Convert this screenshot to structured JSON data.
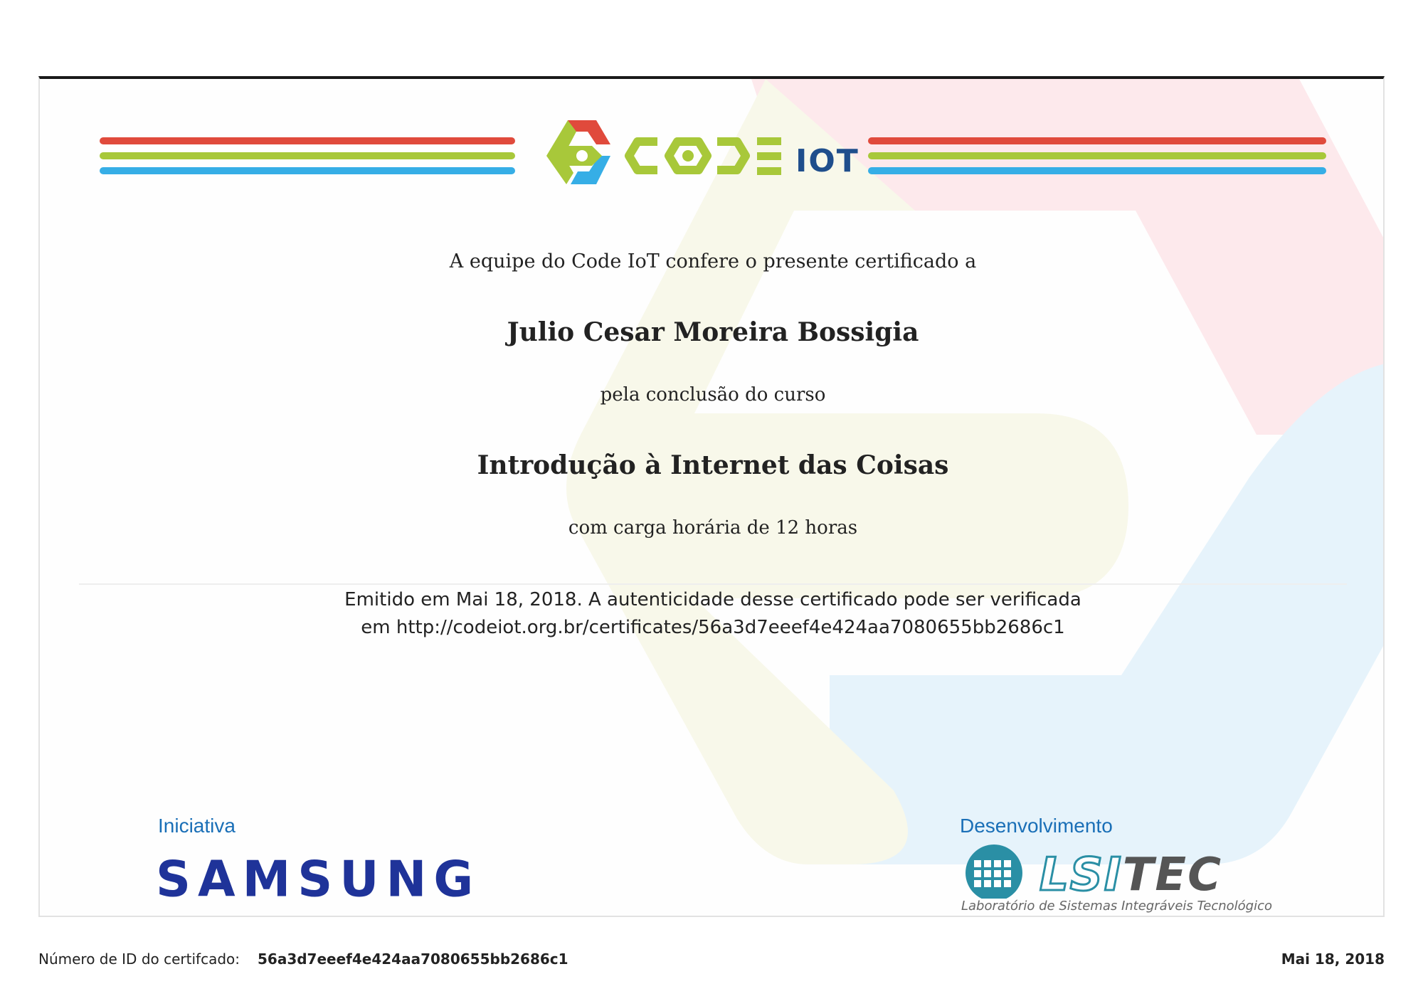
{
  "certificate": {
    "intro": "A equipe do Code IoT confere o presente certificado a",
    "recipient": "Julio Cesar Moreira Bossigia",
    "course_prefix": "pela conclusão do curso",
    "course_name": "Introdução à Internet das Coisas",
    "hours": "com carga horária de 12 horas",
    "issued_line1": "Emitido em Mai 18, 2018. A autenticidade desse certificado pode ser verificada",
    "issued_line2": "em http://codeiot.org.br/certificates/56a3d7eeef4e424aa7080655bb2686c1"
  },
  "logo": {
    "code_text": "CODE",
    "iot_text": "IOT",
    "colors": {
      "red": "#e04a3c",
      "green": "#a8c83a",
      "blue": "#36aee6",
      "navy": "#1f4e8c"
    },
    "icon": "code-iot-hexagon-icon"
  },
  "sponsors": {
    "initiative_label": "Iniciativa",
    "initiative_name": "SAMSUNG",
    "development_label": "Desenvolvimento",
    "development_name_a": "LSI",
    "development_name_b": "TEC",
    "development_caption": "Laboratório de Sistemas Integráveis Tecnológico",
    "brand_colors": {
      "samsung": "#1f3399",
      "lsitec": "#2a8fa5"
    }
  },
  "footer": {
    "id_label": "Número de ID do certifcado:",
    "id_value": "56a3d7eeef4e424aa7080655bb2686c1",
    "date": "Mai 18, 2018"
  }
}
